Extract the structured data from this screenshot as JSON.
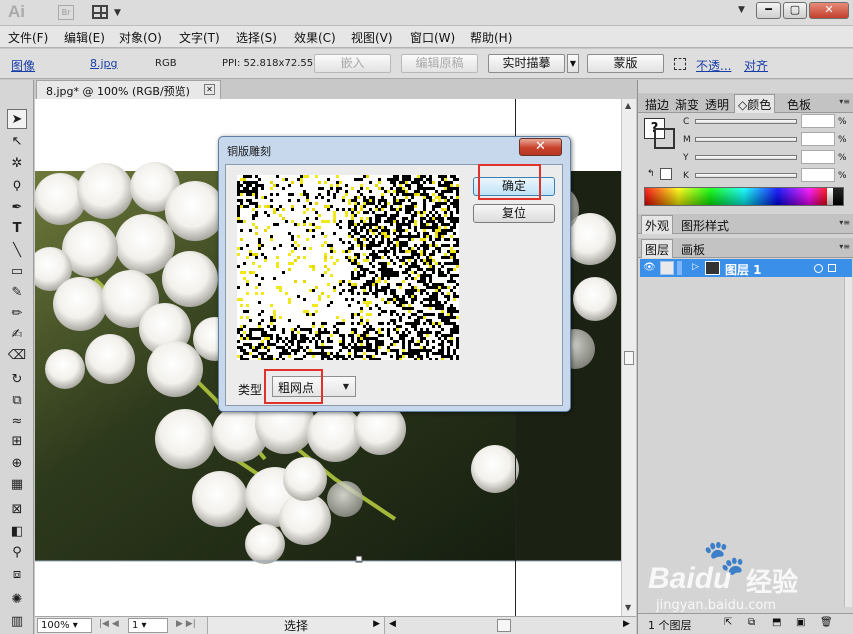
{
  "titlebar": {
    "app_logo": "Ai",
    "bridge_logo": "Br",
    "arrange_dropdown": "▼",
    "search_dropdown": "▼",
    "minimize": "━",
    "maximize": "▢",
    "close": "✕"
  },
  "menu": [
    "文件(F)",
    "编辑(E)",
    "对象(O)",
    "文字(T)",
    "选择(S)",
    "效果(C)",
    "视图(V)",
    "窗口(W)",
    "帮助(H)"
  ],
  "control_bar": {
    "image_link": "图像",
    "file_link": "8.jpg",
    "color_mode": "RGB",
    "ppi": "PPI: 52.818x72.551",
    "embed_button": "嵌入",
    "edit_original_button": "编辑原稿",
    "live_trace_button": "实时描摹",
    "mask_button": "蒙版",
    "opacity_link": "不透...",
    "align_link": "对齐"
  },
  "document": {
    "tab_title": "8.jpg* @ 100% (RGB/预览)",
    "tab_close": "✕"
  },
  "status_bar": {
    "zoom": "100%",
    "artboard_number": "1",
    "tool_status": "选择"
  },
  "dialog": {
    "title": "铜版雕刻",
    "close": "✕",
    "ok_button": "确定",
    "reset_button": "复位",
    "type_label": "类型",
    "type_value": "粗网点"
  },
  "color_panel": {
    "tabs": [
      "描边",
      "渐变",
      "透明",
      "颜色",
      "色板"
    ],
    "active_tab": "颜色",
    "channels": [
      "C",
      "M",
      "Y",
      "K"
    ],
    "percent": "%"
  },
  "appearance_panel": {
    "tabs": [
      "外观",
      "图形样式"
    ]
  },
  "layers_panel": {
    "tabs": [
      "图层",
      "画板"
    ],
    "layer_name": "图层 1",
    "footer_count": "1 个图层",
    "selection_color": "#3a8fe8"
  },
  "watermark": {
    "brand": "Baidu",
    "product": "经验",
    "url": "jingyan.baidu.com"
  }
}
